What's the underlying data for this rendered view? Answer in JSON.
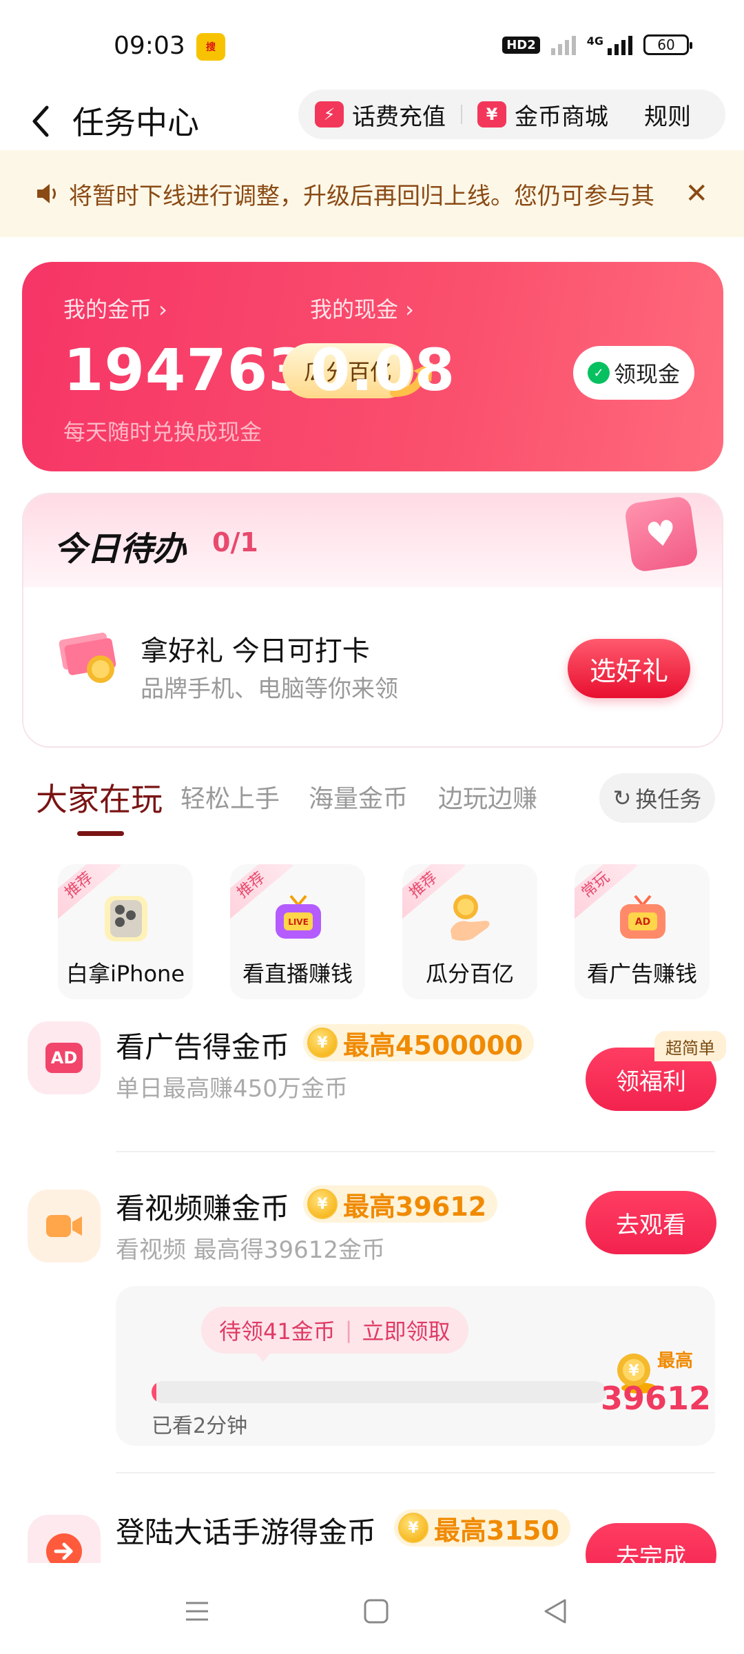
{
  "status_bar": {
    "time": "09:03",
    "app_icon_text": "搜",
    "hd_label": "HD2",
    "network_label": "4G",
    "battery": "60"
  },
  "header": {
    "title": "任务中心",
    "recharge_label": "话费充值",
    "recharge_icon_text": "⚡",
    "mall_label": "金币商城",
    "mall_icon_text": "¥",
    "rules_label": "规则"
  },
  "notice": {
    "text": "将暂时下线进行调整，升级后再回归上线。您仍可参与其"
  },
  "wallet": {
    "coins_label": "我的金币 ›",
    "coins_value": "194763",
    "coins_sub": "每天随时兑换成现金",
    "split_label": "瓜分百亿",
    "cash_label": "我的现金 ›",
    "cash_value": "0.08",
    "claim_cash_label": "领现金"
  },
  "today": {
    "title": "今日待办",
    "count": "0/1",
    "task_title": "拿好礼 今日可打卡",
    "task_sub": "品牌手机、电脑等你来领",
    "pick_label": "选好礼"
  },
  "tabs": {
    "items": [
      "大家在玩",
      "轻松上手",
      "海量金币",
      "边玩边赚"
    ],
    "swap_label": "换任务"
  },
  "plays": [
    {
      "badge": "推荐",
      "label": "白拿iPhone"
    },
    {
      "badge": "推荐",
      "label": "看直播赚钱"
    },
    {
      "badge": "推荐",
      "label": "瓜分百亿"
    },
    {
      "badge": "常玩",
      "label": "看广告赚钱"
    }
  ],
  "tasks": [
    {
      "icon_text": "AD",
      "title": "看广告得金币",
      "reward": "最高4500000",
      "sub": "单日最高赚450万金币",
      "button": "领福利",
      "tag": "超简单"
    },
    {
      "title": "看视频赚金币",
      "reward": "最高39612",
      "sub": "看视频 最高得39612金币",
      "button": "去观看",
      "progress": {
        "pending": "待领41金币",
        "claim": "立即领取",
        "watched": "已看2分钟",
        "max_label": "最高",
        "max_value": "39612",
        "fraction": 0.01
      }
    },
    {
      "title": "登陆大话手游得金币",
      "reward": "最高3150",
      "button": "去完成"
    }
  ],
  "colors": {
    "brand_red": "#f63566",
    "gold": "#f08a00",
    "tab_active": "#7a1414"
  }
}
